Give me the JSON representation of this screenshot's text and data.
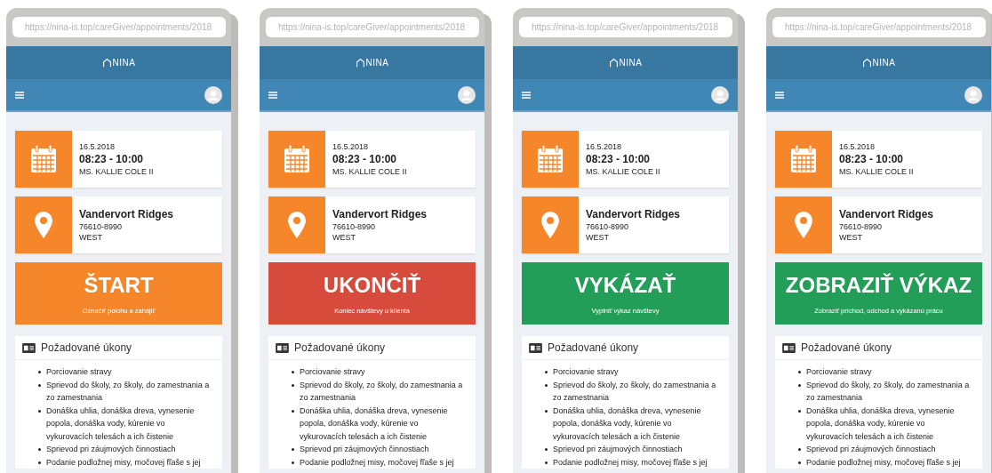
{
  "phones": [
    {
      "url": "https://nina-is.top/careGiver/appointments/2018",
      "logo": "NINA",
      "date": "16.5.2018",
      "time": "08:23 - 10:00",
      "client": "MS. KALLIE COLE II",
      "place": "Vandervort Ridges",
      "zip": "76610-8990",
      "region": "WEST",
      "action": {
        "label": "ŠTART",
        "hint": "Označiť polohu a zahájiť",
        "color": "#f5862a"
      },
      "tasks_title": "Požadované úkony",
      "tasks": [
        "Porciovanie stravy",
        "Sprievod do školy, zo školy, do zamestnania a zo zamestnania",
        "Donáška uhlia, donáška dreva, vynesenie popola, donáška vody, kúrenie vo vykurovacích telesách a ich čistenie",
        "Sprievod pri záujmových činnostiach",
        "Podanie podložnej misy, močovej fľaše s jej"
      ]
    },
    {
      "url": "https://nina-is.top/careGiver/appointments/2018",
      "logo": "NINA",
      "date": "16.5.2018",
      "time": "08:23 - 10:00",
      "client": "MS. KALLIE COLE II",
      "place": "Vandervort Ridges",
      "zip": "76610-8990",
      "region": "WEST",
      "action": {
        "label": "UKONČIŤ",
        "hint": "Koniec návštevy u klienta",
        "color": "#d64b3b"
      },
      "tasks_title": "Požadované úkony",
      "tasks": [
        "Porciovanie stravy",
        "Sprievod do školy, zo školy, do zamestnania a zo zamestnania",
        "Donáška uhlia, donáška dreva, vynesenie popola, donáška vody, kúrenie vo vykurovacích telesách a ich čistenie",
        "Sprievod pri záujmových činnostiach",
        "Podanie podložnej misy, močovej fľaše s jej"
      ]
    },
    {
      "url": "https://nina-is.top/careGiver/appointments/2018",
      "logo": "NINA",
      "date": "16.5.2018",
      "time": "08:23 - 10:00",
      "client": "MS. KALLIE COLE II",
      "place": "Vandervort Ridges",
      "zip": "76610-8990",
      "region": "WEST",
      "action": {
        "label": "VYKÁZAŤ",
        "hint": "Vyplniť výkaz návštevy",
        "color": "#239e59"
      },
      "tasks_title": "Požadované úkony",
      "tasks": [
        "Porciovanie stravy",
        "Sprievod do školy, zo školy, do zamestnania a zo zamestnania",
        "Donáška uhlia, donáška dreva, vynesenie popola, donáška vody, kúrenie vo vykurovacích telesách a ich čistenie",
        "Sprievod pri záujmových činnostiach",
        "Podanie podložnej misy, močovej fľaše s jej"
      ]
    },
    {
      "url": "https://nina-is.top/careGiver/appointments/2018",
      "logo": "NINA",
      "date": "16.5.2018",
      "time": "08:23 - 10:00",
      "client": "MS. KALLIE COLE II",
      "place": "Vandervort Ridges",
      "zip": "76610-8990",
      "region": "WEST",
      "action": {
        "label": "ZOBRAZIŤ VÝKAZ",
        "hint": "Zobraziť príchod, odchod a vykázanú prácu",
        "color": "#239e59"
      },
      "tasks_title": "Požadované úkony",
      "tasks": [
        "Porciovanie stravy",
        "Sprievod do školy, zo školy, do zamestnania a zo zamestnania",
        "Donáška uhlia, donáška dreva, vynesenie popola, donáška vody, kúrenie vo vykurovacích telesách a ich čistenie",
        "Sprievod pri záujmových činnostiach",
        "Podanie podložnej misy, močovej fľaše s jej"
      ]
    }
  ]
}
